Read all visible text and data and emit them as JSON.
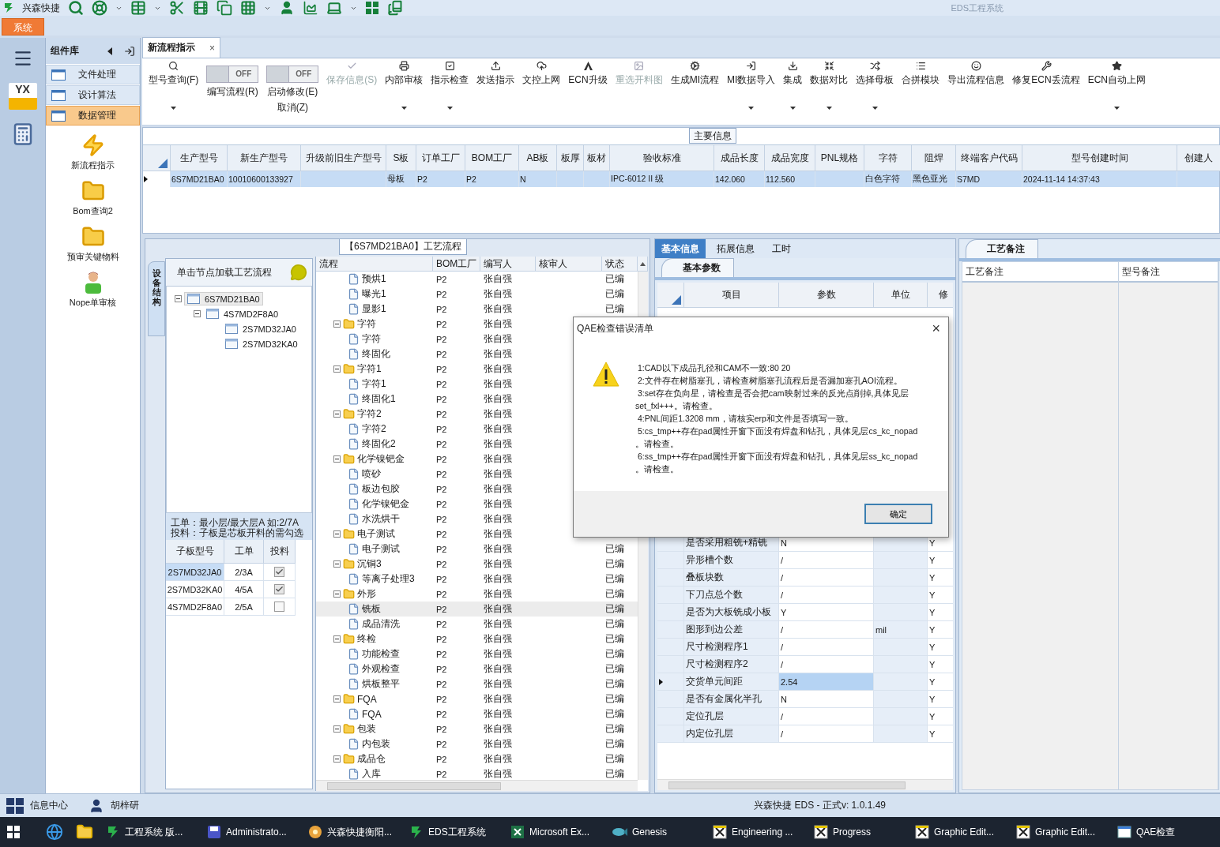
{
  "title_bar": {
    "app_name": "兴森快捷",
    "window_title": "EDS工程系统"
  },
  "ribbon_tabs": [
    {
      "label": "系统",
      "selected": true
    }
  ],
  "rail": [
    {
      "kind": "menu"
    },
    {
      "kind": "logo",
      "text": "YX"
    },
    {
      "kind": "calculator"
    }
  ],
  "component_library": {
    "title": "组件库",
    "items": [
      {
        "label": "文件处理",
        "selected": false
      },
      {
        "label": "设计算法",
        "selected": false
      },
      {
        "label": "数据管理",
        "selected": true
      }
    ],
    "modules": [
      {
        "kind": "bolt",
        "label": "新流程指示"
      },
      {
        "kind": "folder",
        "label": "Bom查询2"
      },
      {
        "kind": "folder",
        "label": "预审关键物料"
      },
      {
        "kind": "person",
        "label": "Nope单审核"
      }
    ]
  },
  "document_tabs": [
    {
      "label": "新流程指示",
      "selected": true,
      "close": "×"
    }
  ],
  "toolbar": [
    {
      "kind": "search",
      "label": "型号查询(F)",
      "disabled": false,
      "dropdown": true
    },
    {
      "kind": "toggle",
      "switch_text": "OFF",
      "on": false,
      "label": "编写流程(R)"
    },
    {
      "kind": "toggle",
      "switch_text": "OFF",
      "on": false,
      "label": "启动修改(E)",
      "sublabel": "取消(Z)"
    },
    {
      "kind": "check",
      "label": "保存信息(S)",
      "disabled": true,
      "dropdown": false
    },
    {
      "kind": "printer",
      "label": "内部审核",
      "disabled": false,
      "dropdown": true
    },
    {
      "kind": "checkbox",
      "label": "指示检查",
      "disabled": false,
      "dropdown": true
    },
    {
      "kind": "upload",
      "label": "发送指示",
      "disabled": false,
      "dropdown": false
    },
    {
      "kind": "cloud",
      "label": "文控上网",
      "disabled": false,
      "dropdown": false
    },
    {
      "kind": "letter",
      "label": "ECN升级",
      "disabled": false,
      "dropdown": false
    },
    {
      "kind": "image",
      "label": "重选开料图",
      "disabled": true,
      "dropdown": false
    },
    {
      "kind": "cogs",
      "label": "生成MI流程",
      "disabled": false,
      "dropdown": false
    },
    {
      "kind": "import",
      "label": "MI数据导入",
      "disabled": false,
      "dropdown": true
    },
    {
      "kind": "download",
      "label": "集成",
      "disabled": false,
      "dropdown": true
    },
    {
      "kind": "compress",
      "label": "数据对比",
      "disabled": false,
      "dropdown": true
    },
    {
      "kind": "shuffle",
      "label": "选择母板",
      "disabled": false,
      "dropdown": true
    },
    {
      "kind": "list",
      "label": "合拼模块",
      "disabled": false,
      "dropdown": false
    },
    {
      "kind": "smile",
      "label": "导出流程信息",
      "disabled": false,
      "dropdown": false
    },
    {
      "kind": "wrench",
      "label": "修复ECN丢流程",
      "disabled": false,
      "dropdown": false
    },
    {
      "kind": "star",
      "label": "ECN自动上网",
      "disabled": false,
      "dropdown": true
    }
  ],
  "main_info": {
    "title": "主要信息",
    "columns": [
      "生产型号",
      "新生产型号",
      "升级前旧生产型号",
      "S板",
      "订单工厂",
      "BOM工厂",
      "AB板",
      "板厚",
      "板材",
      "验收标准",
      "成品长度",
      "成品宽度",
      "PNL规格",
      "字符",
      "阻焊",
      "终端客户代码",
      "型号创建时间",
      "创建人"
    ],
    "rows": [
      {
        "selected": true,
        "cells": [
          "6S7MD21BA0",
          "10010600133927",
          null,
          "母板",
          "P2",
          "P2",
          "N",
          null,
          null,
          "IPC-6012 II 级",
          "142.060",
          "112.560",
          null,
          "白色字符",
          "黑色亚光",
          "S7MD",
          "2024-11-14 14:37:43",
          null
        ]
      }
    ]
  },
  "structure_panel": {
    "side_tab": "设备结构",
    "header": "单击节点加载工艺流程",
    "tree": [
      {
        "label": "6S7MD21BA0",
        "selected": true,
        "expanded": true,
        "children": [
          {
            "label": "4S7MD2F8A0",
            "selected": false,
            "expanded": true,
            "children": [
              {
                "label": "2S7MD32JA0",
                "selected": false
              },
              {
                "label": "2S7MD32KA0",
                "selected": false
              }
            ]
          }
        ]
      }
    ],
    "note": [
      "工单：最小层/最大层A 如:2/7A",
      "投料：子板是芯板开料的需勾选"
    ],
    "columns": [
      "子板型号",
      "工单",
      "投料"
    ],
    "rows": [
      {
        "board": "2S7MD32JA0",
        "order": "2/3A",
        "checked": true,
        "selected": true
      },
      {
        "board": "2S7MD32KA0",
        "order": "4/5A",
        "checked": true,
        "selected": false
      },
      {
        "board": "4S7MD2F8A0",
        "order": "2/5A",
        "checked": false,
        "selected": false
      }
    ]
  },
  "process_flow": {
    "title": "【6S7MD21BA0】工艺流程",
    "columns": [
      "流程",
      "BOM工厂",
      "编写人",
      "核审人",
      "状态"
    ],
    "tree": [
      {
        "children": [
          {
            "label": "预烘1",
            "bom": "P2",
            "author": "张自强",
            "status": "已编",
            "selected": false
          },
          {
            "label": "曝光1",
            "bom": "P2",
            "author": "张自强",
            "status": "已编",
            "selected": false
          },
          {
            "label": "显影1",
            "bom": "P2",
            "author": "张自强",
            "status": "已编",
            "selected": false
          }
        ]
      },
      {
        "label": "字符",
        "bom": "P2",
        "author": "张自强",
        "selected": false,
        "expanded": true,
        "children": [
          {
            "label": "字符",
            "bom": "P2",
            "author": "张自强",
            "selected": false
          },
          {
            "label": "终固化",
            "bom": "P2",
            "author": "张自强",
            "selected": false
          }
        ]
      },
      {
        "label": "字符1",
        "bom": "P2",
        "author": "张自强",
        "selected": false,
        "expanded": true,
        "children": [
          {
            "label": "字符1",
            "bom": "P2",
            "author": "张自强",
            "selected": false
          },
          {
            "label": "终固化1",
            "bom": "P2",
            "author": "张自强",
            "selected": false
          }
        ]
      },
      {
        "label": "字符2",
        "bom": "P2",
        "author": "张自强",
        "selected": false,
        "expanded": true,
        "children": [
          {
            "label": "字符2",
            "bom": "P2",
            "author": "张自强",
            "selected": false
          },
          {
            "label": "终固化2",
            "bom": "P2",
            "author": "张自强",
            "selected": false
          }
        ]
      },
      {
        "label": "化学镍钯金",
        "bom": "P2",
        "author": "张自强",
        "selected": false,
        "expanded": true,
        "children": [
          {
            "label": "喷砂",
            "bom": "P2",
            "author": "张自强",
            "selected": false
          },
          {
            "label": "板边包胶",
            "bom": "P2",
            "author": "张自强",
            "selected": false
          },
          {
            "label": "化学镍钯金",
            "bom": "P2",
            "author": "张自强",
            "selected": false
          },
          {
            "label": "水洗烘干",
            "bom": "P2",
            "author": "张自强",
            "selected": false
          }
        ]
      },
      {
        "label": "电子测试",
        "bom": "P2",
        "author": "张自强",
        "selected": false,
        "expanded": true,
        "children": [
          {
            "label": "电子测试",
            "bom": "P2",
            "author": "张自强",
            "status": "已编",
            "selected": false
          }
        ]
      },
      {
        "label": "沉铜3",
        "bom": "P2",
        "author": "张自强",
        "status": "已编",
        "selected": false,
        "expanded": true,
        "children": [
          {
            "label": "等离子处理3",
            "bom": "P2",
            "author": "张自强",
            "status": "已编",
            "selected": false
          }
        ]
      },
      {
        "label": "外形",
        "bom": "P2",
        "author": "张自强",
        "status": "已编",
        "selected": false,
        "expanded": true,
        "children": [
          {
            "label": "铣板",
            "bom": "P2",
            "author": "张自强",
            "status": "已编",
            "selected": true
          },
          {
            "label": "成品清洗",
            "bom": "P2",
            "author": "张自强",
            "status": "已编",
            "selected": false
          }
        ]
      },
      {
        "label": "终检",
        "bom": "P2",
        "author": "张自强",
        "status": "已编",
        "selected": false,
        "expanded": true,
        "children": [
          {
            "label": "功能检查",
            "bom": "P2",
            "author": "张自强",
            "status": "已编",
            "selected": false
          },
          {
            "label": "外观检查",
            "bom": "P2",
            "author": "张自强",
            "status": "已编",
            "selected": false
          },
          {
            "label": "烘板整平",
            "bom": "P2",
            "author": "张自强",
            "status": "已编",
            "selected": false
          }
        ]
      },
      {
        "label": "FQA",
        "bom": "P2",
        "author": "张自强",
        "status": "已编",
        "selected": false,
        "expanded": true,
        "children": [
          {
            "label": "FQA",
            "bom": "P2",
            "author": "张自强",
            "status": "已编",
            "selected": false
          }
        ]
      },
      {
        "label": "包装",
        "bom": "P2",
        "author": "张自强",
        "status": "已编",
        "selected": false,
        "expanded": true,
        "children": [
          {
            "label": "内包装",
            "bom": "P2",
            "author": "张自强",
            "status": "已编",
            "selected": false
          }
        ]
      },
      {
        "label": "成品仓",
        "bom": "P2",
        "author": "张自强",
        "status": "已编",
        "selected": false,
        "expanded": true,
        "children": [
          {
            "label": "入库",
            "bom": "P2",
            "author": "张自强",
            "status": "已编",
            "selected": false
          }
        ]
      }
    ]
  },
  "properties": {
    "tabs": [
      {
        "label": "基本信息",
        "selected": true
      },
      {
        "label": "拓展信息",
        "selected": false
      },
      {
        "label": "工时",
        "selected": false
      }
    ],
    "subtab": "基本参数",
    "columns": [
      "项目",
      "参数",
      "单位",
      "修"
    ],
    "rows": [
      {
        "item": "是否采用粗铣+精铣",
        "value": "N",
        "modified": "Y",
        "selected": false
      },
      {
        "item": "异形槽个数",
        "value": "/",
        "modified": "Y",
        "selected": false
      },
      {
        "item": "叠板块数",
        "value": "/",
        "modified": "Y",
        "selected": false
      },
      {
        "item": "下刀点总个数",
        "value": "/",
        "modified": "Y",
        "selected": false
      },
      {
        "item": "是否为大板铣成小板",
        "value": "Y",
        "modified": "Y",
        "selected": false
      },
      {
        "item": "图形到边公差",
        "value": "/",
        "unit": "mil",
        "modified": "Y",
        "selected": false
      },
      {
        "item": "尺寸检测程序1",
        "value": "/",
        "modified": "Y",
        "selected": false
      },
      {
        "item": "尺寸检测程序2",
        "value": "/",
        "modified": "Y",
        "selected": false
      },
      {
        "item": "交货单元间距",
        "value": "2.54",
        "modified": "Y",
        "selected": true
      },
      {
        "item": "是否有金属化半孔",
        "value": "N",
        "modified": "Y",
        "selected": false
      },
      {
        "item": "定位孔层",
        "value": "/",
        "modified": "Y",
        "selected": false
      },
      {
        "item": "内定位孔层",
        "value": "/",
        "modified": "Y",
        "selected": false
      }
    ]
  },
  "notes_panel": {
    "tab": "工艺备注",
    "columns": [
      "工艺备注",
      "型号备注"
    ]
  },
  "dialog": {
    "title": "QAE检查错误清单",
    "close": "×",
    "button": "确定",
    "lines": [
      {
        "text": "1:CAD以下成品孔径和CAM不一致:80 20",
        "continuation": false
      },
      {
        "text": "2:文件存在树脂塞孔，请检查树脂塞孔流程后是否漏加塞孔AOI流程。",
        "continuation": false
      },
      {
        "text": "3:set存在负向星，请检查是否会把cam映射过来的反光点削掉,具体见层",
        "continuation": false
      },
      {
        "text": "set_fxl+++。请检查。",
        "continuation": true
      },
      {
        "text": "4:PNL间距1.3208 mm，请核实erp和文件是否填写一致。",
        "continuation": false
      },
      {
        "text": "5:cs_tmp++存在pad属性开窗下面没有焊盘和钻孔，具体见层cs_kc_nopad",
        "continuation": false
      },
      {
        "text": "。请检查。",
        "continuation": true
      },
      {
        "text": "6:ss_tmp++存在pad属性开窗下面没有焊盘和钻孔，具体见层ss_kc_nopad",
        "continuation": false
      },
      {
        "text": "。请检查。",
        "continuation": true
      }
    ]
  },
  "status_bar": {
    "items": [
      {
        "kind": "grid",
        "label": "信息中心"
      },
      {
        "kind": "user",
        "label": "胡梓研"
      }
    ],
    "version": "兴森快捷 EDS - 正式v: 1.0.1.49"
  },
  "taskbar": [
    {
      "kind": "browser"
    },
    {
      "kind": "folder"
    },
    {
      "kind": "eds",
      "label": "工程系统 版..."
    },
    {
      "kind": "disk",
      "label": "Administrato..."
    },
    {
      "kind": "flower",
      "label": "兴森快捷衡阳..."
    },
    {
      "kind": "eds",
      "label": "EDS工程系统"
    },
    {
      "kind": "excel",
      "label": "Microsoft Ex..."
    },
    {
      "kind": "genesis",
      "label": "Genesis"
    },
    {
      "kind": "xwin",
      "label": "Engineering ..."
    },
    {
      "kind": "xwin",
      "label": "Progress"
    },
    {
      "kind": "xwin",
      "label": "Graphic Edit..."
    },
    {
      "kind": "xwin",
      "label": "Graphic Edit..."
    },
    {
      "kind": "window",
      "label": "QAE检查"
    }
  ]
}
